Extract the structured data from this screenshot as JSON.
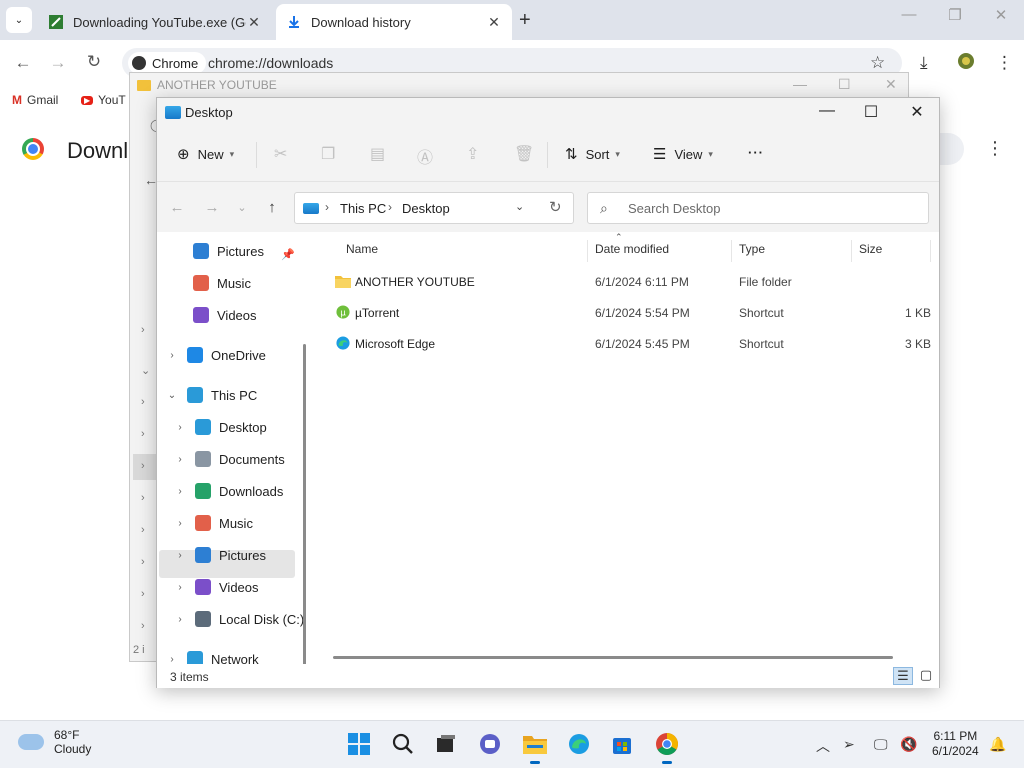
{
  "chrome": {
    "tabs": [
      {
        "title": "Downloading YouTube.exe (Go",
        "active": false
      },
      {
        "title": "Download history",
        "active": true
      }
    ],
    "chip_label": "Chrome",
    "url": "chrome://downloads",
    "bookmarks": [
      {
        "label": "Gmail"
      },
      {
        "label": "YouT"
      }
    ],
    "page_title": "Downl"
  },
  "back_window": {
    "title": "ANOTHER YOUTUBE",
    "status_partial": "2 i"
  },
  "explorer": {
    "title": "Desktop",
    "commands": {
      "new": "New",
      "sort": "Sort",
      "view": "View",
      "more": "···"
    },
    "breadcrumb": [
      "This PC",
      "Desktop"
    ],
    "search_placeholder": "Search Desktop",
    "nav_items": [
      {
        "label": "Pictures",
        "icon": "pictures-icon",
        "color": "#2d7fd3",
        "chevron": "",
        "indent": 36
      },
      {
        "label": "Music",
        "icon": "music-icon",
        "color": "#e2604a",
        "chevron": "",
        "indent": 36
      },
      {
        "label": "Videos",
        "icon": "videos-icon",
        "color": "#7b4fc9",
        "chevron": "",
        "indent": 36
      },
      {
        "label": "OneDrive",
        "icon": "onedrive-icon",
        "color": "#1e88e5",
        "chevron": "›",
        "indent": 8
      },
      {
        "label": "This PC",
        "icon": "this-pc-icon",
        "color": "#2a9ad8",
        "chevron": "⌄",
        "indent": 8
      },
      {
        "label": "Desktop",
        "icon": "desktop-icon",
        "color": "#2a9ad8",
        "chevron": "›",
        "indent": 16
      },
      {
        "label": "Documents",
        "icon": "documents-icon",
        "color": "#8a96a3",
        "chevron": "›",
        "indent": 16
      },
      {
        "label": "Downloads",
        "icon": "downloads-icon",
        "color": "#26a269",
        "chevron": "›",
        "indent": 16
      },
      {
        "label": "Music",
        "icon": "music-icon",
        "color": "#e2604a",
        "chevron": "›",
        "indent": 16
      },
      {
        "label": "Pictures",
        "icon": "pictures-icon",
        "color": "#2d7fd3",
        "chevron": "›",
        "indent": 16
      },
      {
        "label": "Videos",
        "icon": "videos-icon",
        "color": "#7b4fc9",
        "chevron": "›",
        "indent": 16
      },
      {
        "label": "Local Disk (C:)",
        "icon": "local-disk-icon",
        "color": "#5c6b7a",
        "chevron": "›",
        "indent": 16
      },
      {
        "label": "Network",
        "icon": "network-icon",
        "color": "#2a9ad8",
        "chevron": "›",
        "indent": 8
      }
    ],
    "columns": {
      "name": "Name",
      "date": "Date modified",
      "type": "Type",
      "size": "Size"
    },
    "files": [
      {
        "name": "ANOTHER YOUTUBE",
        "date": "6/1/2024 6:11 PM",
        "type": "File folder",
        "size": "",
        "icon": "folder-icon"
      },
      {
        "name": "µTorrent",
        "date": "6/1/2024 5:54 PM",
        "type": "Shortcut",
        "size": "1 KB",
        "icon": "utorrent-icon"
      },
      {
        "name": "Microsoft Edge",
        "date": "6/1/2024 5:45 PM",
        "type": "Shortcut",
        "size": "3 KB",
        "icon": "edge-icon"
      }
    ],
    "item_count": "3 items"
  },
  "taskbar": {
    "temp": "68°F",
    "condition": "Cloudy",
    "time": "6:11 PM",
    "date": "6/1/2024"
  }
}
